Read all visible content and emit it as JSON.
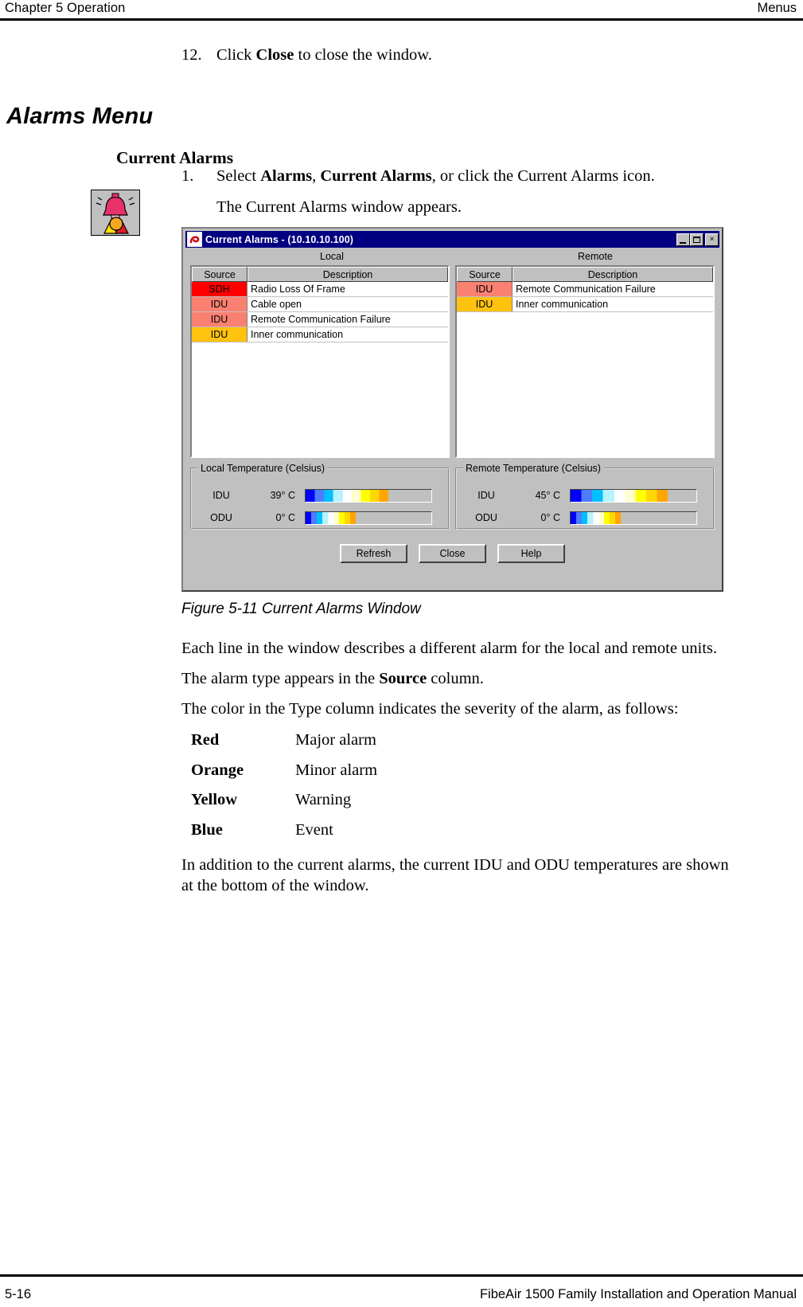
{
  "header": {
    "left": "Chapter 5  Operation",
    "right": "Menus"
  },
  "footer": {
    "page_number": "5-16",
    "manual_title": "FibeAir 1500 Family Installation and Operation Manual"
  },
  "steps": {
    "step12_number": "12.",
    "step12_pre": "Click ",
    "step12_bold": "Close",
    "step12_post": " to close the window.",
    "step1_number": "1.",
    "step1_pre": "Select ",
    "step1_bold1": "Alarms",
    "step1_mid1": ", ",
    "step1_bold2": "Current Alarms",
    "step1_post": ", or click the Current Alarms icon.",
    "step1_sub": "The Current Alarms window appears."
  },
  "headings": {
    "section": "Alarms Menu",
    "subsection": "Current Alarms"
  },
  "dialog": {
    "title": "Current Alarms - (10.10.10.100)",
    "title_icon": "ceragon-logo-icon",
    "window_buttons": {
      "minimize": "minimize-button",
      "maximize": "maximize-button",
      "close": "×"
    },
    "panels": {
      "local_label": "Local",
      "remote_label": "Remote"
    },
    "columns": {
      "source": "Source",
      "description": "Description"
    },
    "local_alarms": [
      {
        "source": "SDH",
        "description": "Radio Loss Of Frame",
        "color": "#ff0000"
      },
      {
        "source": "IDU",
        "description": "Cable open",
        "color": "#fa8072"
      },
      {
        "source": "IDU",
        "description": "Remote Communication Failure",
        "color": "#fa8072"
      },
      {
        "source": "IDU",
        "description": "Inner communication",
        "color": "#ffc20e"
      }
    ],
    "remote_alarms": [
      {
        "source": "IDU",
        "description": "Remote Communication Failure",
        "color": "#fa8072"
      },
      {
        "source": "IDU",
        "description": "Inner communication",
        "color": "#ffc20e"
      }
    ],
    "local_temperature": {
      "legend": "Local Temperature (Celsius)",
      "rows": [
        {
          "unit": "IDU",
          "value": "39° C",
          "fill_percent": 66
        },
        {
          "unit": "ODU",
          "value": "0° C",
          "fill_percent": 40
        }
      ]
    },
    "remote_temperature": {
      "legend": "Remote Temperature (Celsius)",
      "rows": [
        {
          "unit": "IDU",
          "value": "45° C",
          "fill_percent": 77
        },
        {
          "unit": "ODU",
          "value": "0° C",
          "fill_percent": 40
        }
      ]
    },
    "buttons": {
      "refresh": "Refresh",
      "close": "Close",
      "help": "Help"
    }
  },
  "figure": {
    "caption": "Figure 5-11  Current Alarms Window"
  },
  "body": {
    "para1": "Each line in the window describes a different alarm for the local and remote units.",
    "para2_pre": "The alarm type appears in the ",
    "para2_bold": "Source",
    "para2_post": " column.",
    "para3": "The color in the Type column indicates the severity of the alarm, as follows:",
    "closing": "In addition to the current alarms, the current IDU and ODU temperatures are shown at the bottom of the window."
  },
  "severity_legend": [
    {
      "color": "Red",
      "meaning": "Major alarm"
    },
    {
      "color": "Orange",
      "meaning": "Minor alarm"
    },
    {
      "color": "Yellow",
      "meaning": "Warning"
    },
    {
      "color": "Blue",
      "meaning": "Event"
    }
  ]
}
